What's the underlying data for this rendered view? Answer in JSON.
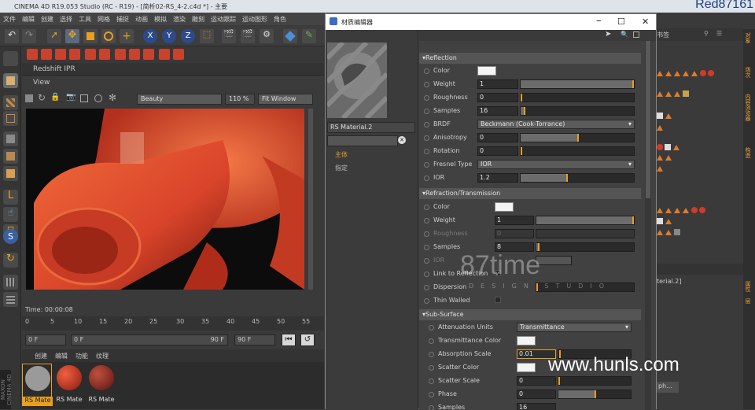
{
  "app": {
    "title": "CINEMA 4D R19.053 Studio (RC - R19) - [简析02-RS_4-2.c4d *] - 主要",
    "brand": "Red87161"
  },
  "menu": [
    "文件",
    "编辑",
    "创建",
    "选择",
    "工具",
    "网格",
    "捕捉",
    "动画",
    "模拟",
    "渲染",
    "雕刻",
    "运动跟踪",
    "运动图形",
    "角色"
  ],
  "ipr": {
    "title": "Redshift IPR",
    "view_label": "View",
    "aov": "Beauty",
    "zoom": "110 %",
    "fit": "Fit Window"
  },
  "timeline": {
    "time": "Time: 00:00:08",
    "ticks": [
      "0",
      "5",
      "10",
      "15",
      "20",
      "25",
      "30",
      "35",
      "40",
      "45",
      "50",
      "55"
    ],
    "start": "0 F",
    "current": "0 F",
    "end_a": "90 F",
    "end_b": "90 F"
  },
  "material_manager": {
    "menu": [
      "创建",
      "编辑",
      "功能",
      "纹理"
    ],
    "materials": [
      "RS Mate",
      "RS Mate",
      "RS Mate"
    ],
    "maxon": "MAXON CINEMA 4D"
  },
  "material_editor": {
    "title": "材质编辑器",
    "controls": [
      "–",
      "☐",
      "✕"
    ],
    "material_name": "RS Material.2",
    "channels": [
      "主体",
      "指定"
    ],
    "reflection": {
      "header": "Reflection",
      "color_label": "Color",
      "weight_label": "Weight",
      "weight": "1",
      "roughness_label": "Roughness",
      "roughness": "0",
      "samples_label": "Samples",
      "samples": "16",
      "brdf_label": "BRDF",
      "brdf": "Beckmann (Cook-Torrance)",
      "anisotropy_label": "Anisotropy",
      "anisotropy": "0",
      "rotation_label": "Rotation",
      "rotation": "0",
      "fresnel_label": "Fresnel Type",
      "fresnel": "IOR",
      "ior_label": "IOR",
      "ior": "1.2"
    },
    "refraction": {
      "header": "Refraction/Transmission",
      "color_label": "Color",
      "weight_label": "Weight",
      "weight": "1",
      "roughness_label": "Roughness",
      "roughness": "0",
      "samples_label": "Samples",
      "samples": "8",
      "ior_label": "IOR",
      "link_label": "Link to Reflection",
      "dispersion_label": "Dispersion",
      "thin_label": "Thin Walled"
    },
    "subsurface": {
      "header": "Sub-Surface",
      "units_label": "Attenuation Units",
      "units": "Transmittance",
      "tcolor_label": "Transmittance Color",
      "abs_label": "Absorption Scale",
      "abs": "0.01",
      "scolor_label": "Scatter Color",
      "sscale_label": "Scatter Scale",
      "sscale": "0",
      "phase_label": "Phase",
      "phase": "0",
      "samples_label": "Samples",
      "samples": "16"
    }
  },
  "right_panel": {
    "tab": "书签",
    "material_ref": "terial.2]",
    "tag_label": "ph...",
    "side_tabs": [
      "对象",
      "场次",
      "内容浏览器",
      "构造",
      "属性",
      "层"
    ]
  },
  "watermark": {
    "main": "www.hunls.com",
    "overlay": "87time",
    "overlay_sub": "DESIGN STUDIO"
  },
  "colors": {
    "accent": "#e8a020",
    "render_orange": "#d9442a"
  }
}
